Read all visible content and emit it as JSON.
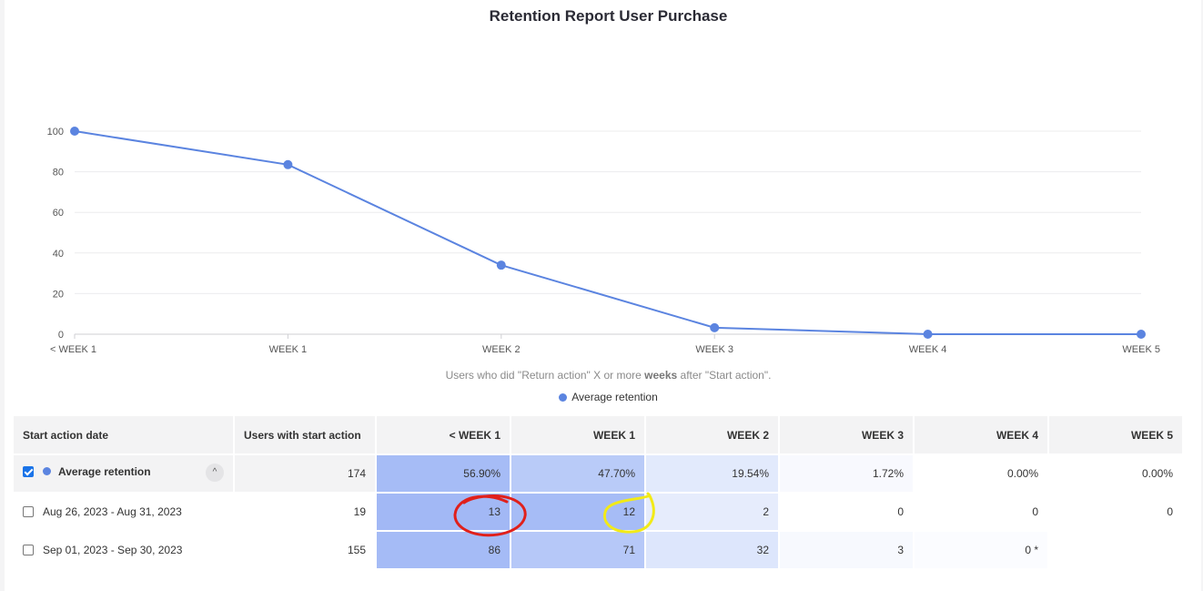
{
  "report": {
    "title": "Retention Report User Purchase",
    "caption_prefix": "Users who did \"Return action\" X or more ",
    "caption_bold": "weeks",
    "caption_suffix": " after \"Start action\".",
    "legend_label": "Average retention"
  },
  "colors": {
    "series": "#5b84e0",
    "annotation_red": "#e0201b",
    "annotation_yellow": "#f2ea17"
  },
  "chart_data": {
    "type": "line",
    "categories": [
      "< WEEK 1",
      "WEEK 1",
      "WEEK 2",
      "WEEK 3",
      "WEEK 4",
      "WEEK 5"
    ],
    "series": [
      {
        "name": "Average retention",
        "values": [
          100,
          83.5,
          34,
          3.2,
          0,
          0
        ]
      }
    ],
    "y_ticks": [
      "100",
      "80",
      "60",
      "40",
      "20",
      "0"
    ],
    "ylim": [
      0,
      100
    ],
    "grid": true,
    "legend_position": "bottom"
  },
  "table": {
    "headers": [
      "Start action date",
      "Users with start action",
      "< WEEK 1",
      "WEEK 1",
      "WEEK 2",
      "WEEK 3",
      "WEEK 4",
      "WEEK 5"
    ],
    "average": {
      "label": "Average retention",
      "users": "174",
      "values": [
        "56.90%",
        "47.70%",
        "19.54%",
        "1.72%",
        "0.00%",
        "0.00%"
      ],
      "collapse_icon": "^"
    },
    "rows": [
      {
        "label": "Aug 26, 2023 - Aug 31, 2023",
        "users": "19",
        "values": [
          "13",
          "12",
          "2",
          "0",
          "0",
          "0"
        ]
      },
      {
        "label": "Sep 01, 2023 - Sep 30, 2023",
        "users": "155",
        "values": [
          "86",
          "71",
          "32",
          "3",
          "0 *",
          ""
        ]
      }
    ],
    "heat": [
      [
        "#a6bcf6",
        "#b9cbf8",
        "#e2eafc",
        "#f8f9fe",
        "#ffffff",
        "#ffffff"
      ],
      [
        "#a2b8f5",
        "#a6bcf6",
        "#e6ecfc",
        "#ffffff",
        "#ffffff",
        "#ffffff"
      ],
      [
        "#a5bbf6",
        "#b6c8f8",
        "#dde6fc",
        "#f7f9fe",
        "#fbfcff",
        "#ffffff"
      ]
    ]
  }
}
